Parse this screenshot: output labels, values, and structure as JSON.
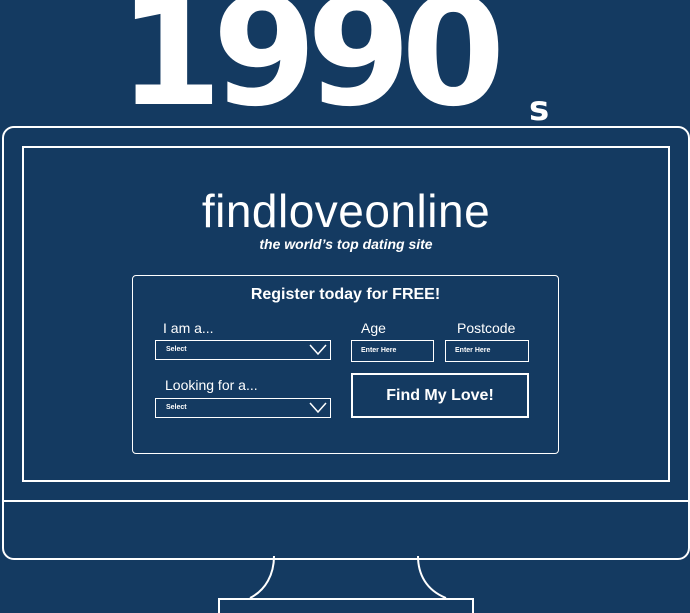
{
  "banner": {
    "year": "1990",
    "suffix": "s"
  },
  "site": {
    "brand": "findloveonline",
    "tagline": "the world’s top dating site"
  },
  "form": {
    "title": "Register today for FREE!",
    "i_am_label": "I am a...",
    "i_am_value": "Select",
    "looking_label": "Looking for a...",
    "looking_value": "Select",
    "age_label": "Age",
    "age_placeholder": "Enter Here",
    "postcode_label": "Postcode",
    "postcode_placeholder": "Enter Here",
    "submit_label": "Find My Love!"
  },
  "icons": {
    "dropdown": "chevron-down-icon"
  },
  "colors": {
    "background": "#143a61",
    "foreground": "#ffffff"
  }
}
